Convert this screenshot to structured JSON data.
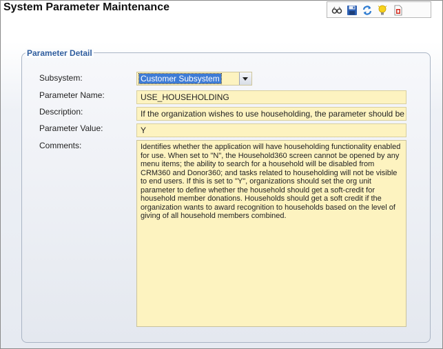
{
  "window": {
    "title": "System Parameter Maintenance"
  },
  "toolbar": {
    "icons": [
      "glasses-icon",
      "save-icon",
      "refresh-icon",
      "lightbulb-icon",
      "delete-icon"
    ]
  },
  "parameter_detail": {
    "legend": "Parameter Detail",
    "subsystem": {
      "label": "Subsystem:",
      "value": "Customer Subsystem"
    },
    "parameter_name": {
      "label": "Parameter Name:",
      "value": "USE_HOUSEHOLDING"
    },
    "description": {
      "label": "Description:",
      "value": "If the organization wishes to use householding, the parameter should be sett"
    },
    "parameter_value": {
      "label": "Parameter Value:",
      "value": "Y"
    },
    "comments": {
      "label": "Comments:",
      "value": "Identifies whether the application will have householding functionality enabled for use. When set to \"N\", the Household360 screen cannot be opened by any menu items; the ability to search for a household will be disabled from CRM360 and Donor360; and tasks related to householding will not be visible to end users.  If this is set to \"Y\", organizations should set the org unit parameter to define whether the household should get a soft-credit for household member donations. Households should get a soft credit if the organization wants to award recognition to households based on the level of giving of all household members combined."
    }
  },
  "colors": {
    "field_bg": "#fdf3c0",
    "legend": "#2f5d9e",
    "selection": "#3d7bd6"
  }
}
